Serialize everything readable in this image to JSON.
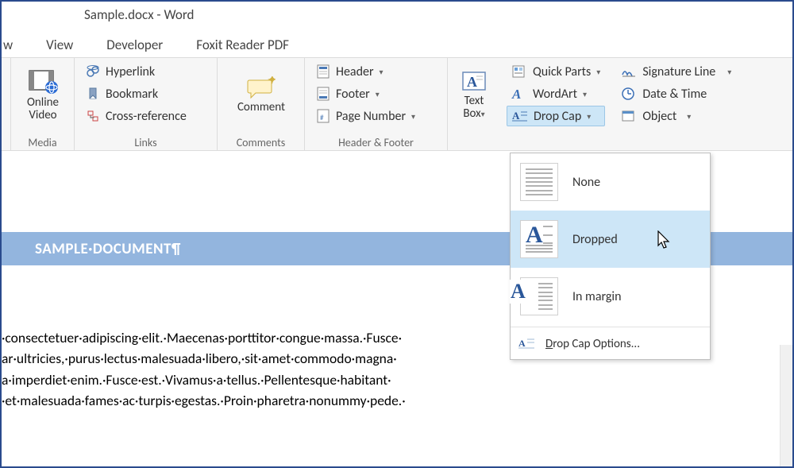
{
  "title": "Sample.docx - Word",
  "tabs": {
    "t0": "w",
    "t1": "View",
    "t2": "Developer",
    "t3": "Foxit Reader PDF"
  },
  "groups": {
    "media": {
      "label": "Media",
      "online_video": "Online\nVideo"
    },
    "links": {
      "label": "Links",
      "hyperlink": "Hyperlink",
      "bookmark": "Bookmark",
      "crossref": "Cross-reference"
    },
    "comments": {
      "label": "Comments",
      "comment": "Comment"
    },
    "headerfooter": {
      "label": "Header & Footer",
      "header": "Header",
      "footer": "Footer",
      "pagenum": "Page Number"
    },
    "text": {
      "textbox": "Text\nBox",
      "quickparts": "Quick Parts",
      "wordart": "WordArt",
      "dropcap": "Drop Cap",
      "sigline": "Signature Line",
      "datetime": "Date & Time",
      "object": "Object"
    }
  },
  "dropdown": {
    "none": "None",
    "dropped": "Dropped",
    "inmargin": "In margin",
    "options": "Drop Cap Options..."
  },
  "banner": "SAMPLE·DOCUMENT¶",
  "body": {
    "l1": "·consectetuer·adipiscing·elit.·Maecenas·porttitor·congue·massa.·Fusce·",
    "l2": "ar·ultricies,·purus·lectus·malesuada·libero,·sit·amet·commodo·magna·",
    "l3": "a·imperdiet·enim.·Fusce·est.·Vivamus·a·tellus.·Pellentesque·habitant·",
    "l4": "·et·malesuada·fames·ac·turpis·egestas.·Proin·pharetra·nonummy·pede.·"
  }
}
